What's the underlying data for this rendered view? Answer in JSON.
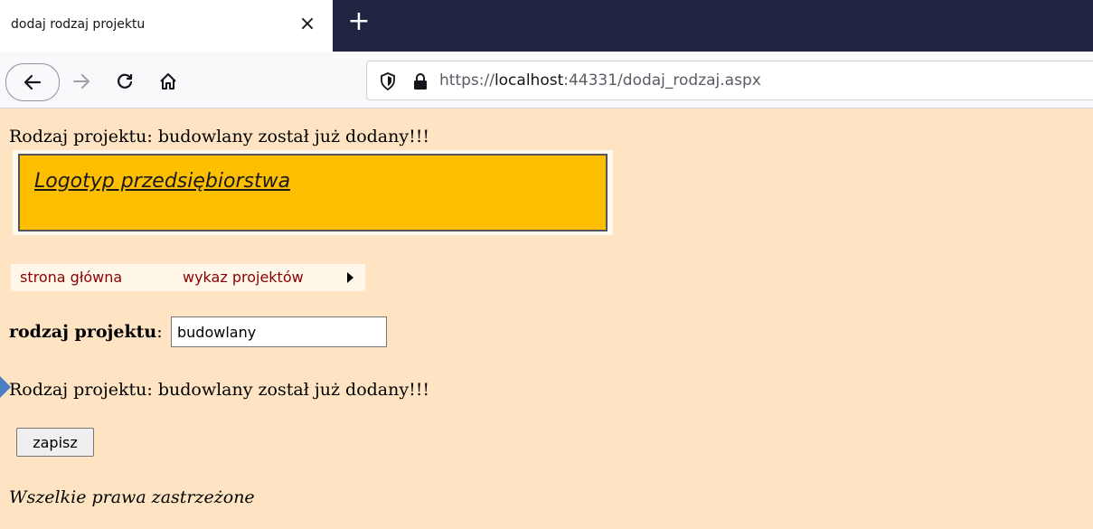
{
  "browser": {
    "tab_title": "dodaj rodzaj projektu",
    "close_symbol": "×",
    "new_tab_symbol": "+",
    "url_prefix": "https://",
    "url_host": "localhost",
    "url_rest": ":44331/dodaj_rodzaj.aspx"
  },
  "page": {
    "top_message": "Rodzaj projektu: budowlany został już dodany!!!",
    "logo_text": "Logotyp przedsiębiorstwa",
    "menu": {
      "home": "strona główna",
      "projects": "wykaz projektów"
    },
    "field": {
      "label": "rodzaj projektu",
      "label_suffix": ":",
      "value": "budowlany"
    },
    "message": "Rodzaj projektu: budowlany został już dodany!!!",
    "save_label": "zapisz",
    "footer": "Wszelkie prawa zastrzeżone"
  },
  "colors": {
    "page_background": "#ffe4c4",
    "logo_background": "#fdbf00",
    "menu_text": "#8b0000",
    "tabbar": "#1f2540"
  }
}
